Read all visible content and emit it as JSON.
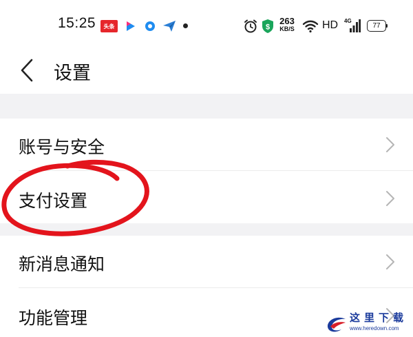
{
  "status_bar": {
    "time": "15:25",
    "notif_icons": [
      "toutiao-app-icon",
      "youku-app-icon",
      "circle-app-icon",
      "paper-plane-icon",
      "more-dot-icon"
    ],
    "toutiao_text": "头条",
    "net_speed_value": "263",
    "net_speed_unit": "KB/S",
    "hd_label": "HD",
    "signal_label": "4G",
    "battery_level": "77"
  },
  "header": {
    "back_icon": "chevron-left-icon",
    "title": "设置"
  },
  "settings": {
    "items": [
      {
        "label": "账号与安全"
      },
      {
        "label": "支付设置"
      },
      {
        "label": "新消息通知"
      },
      {
        "label": "功能管理"
      }
    ],
    "item_icon": "chevron-right-icon"
  },
  "annotation": {
    "color": "#e3141c",
    "target": "支付设置"
  },
  "watermark": {
    "text": "这里下载",
    "url": "www.heredown.com",
    "color": "#1b3b9c"
  },
  "colors": {
    "background": "#ffffff",
    "section_gap": "#f2f2f4",
    "text": "#111111",
    "chevron": "#b5b5b5"
  }
}
